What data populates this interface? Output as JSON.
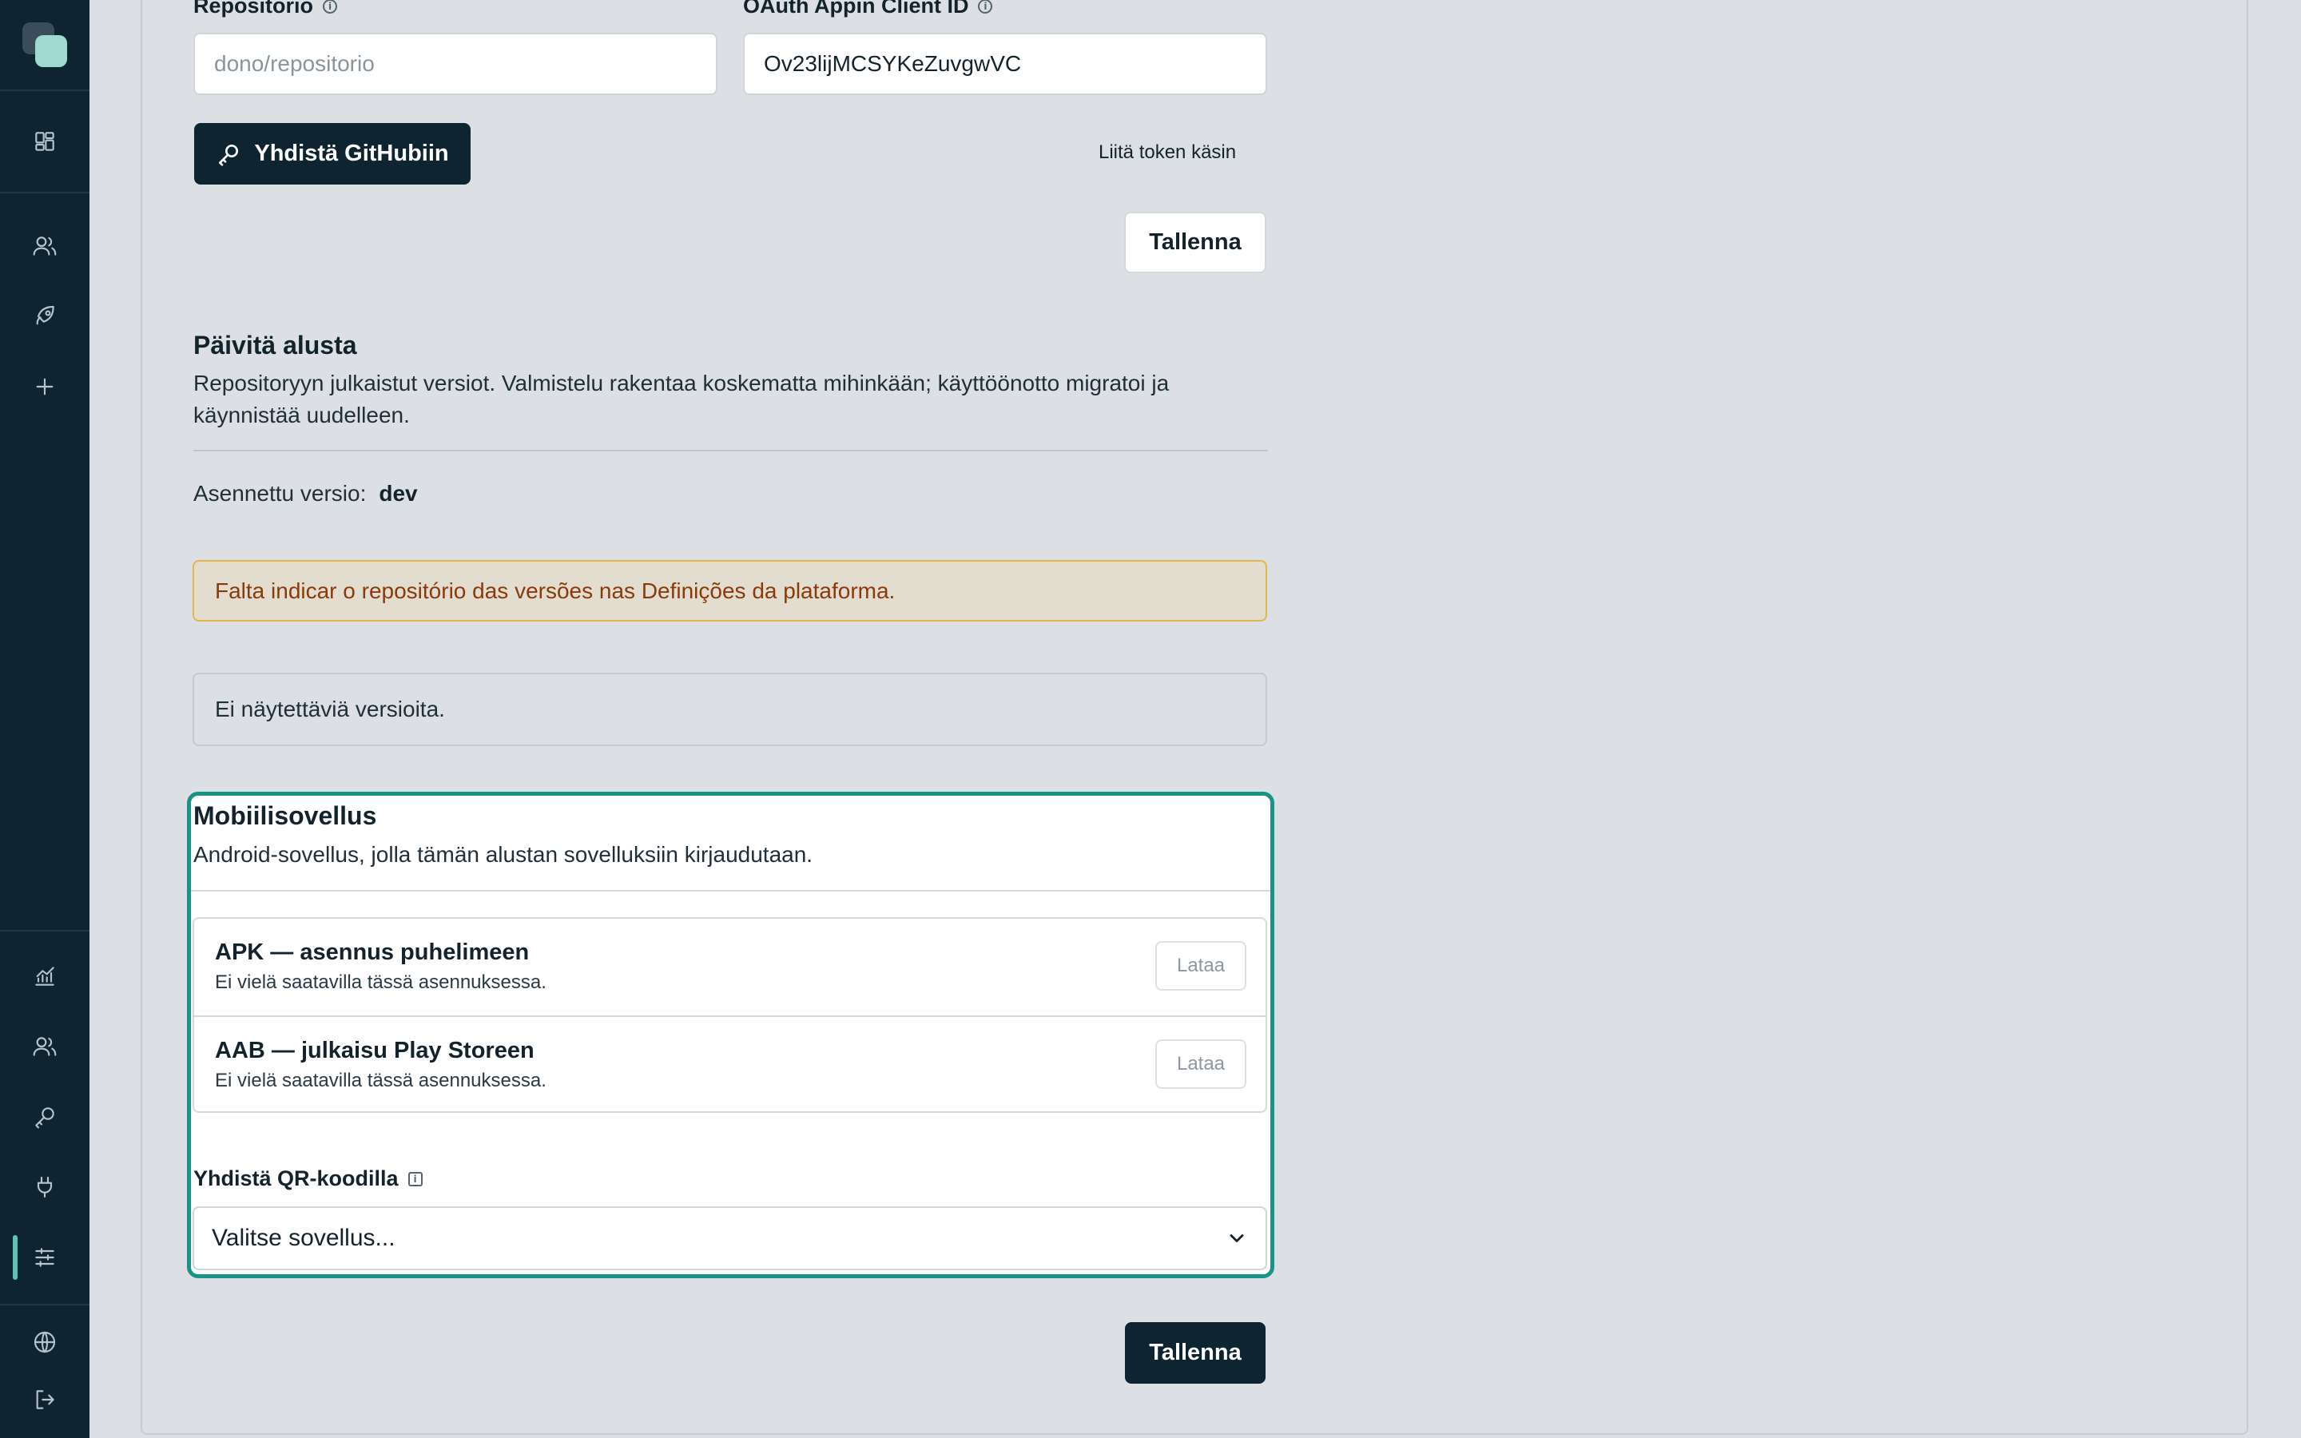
{
  "github": {
    "repo_label": "Repositorio",
    "repo_placeholder": "dono/repositorio",
    "client_id_label": "OAuth Appin Client ID",
    "client_id_value": "Ov23lijMCSYKeZuvgwVC",
    "connect_button": "Yhdistä GitHubiin",
    "manual_token_link": "Liitä token käsin",
    "save_button": "Tallenna"
  },
  "update": {
    "title": "Päivitä alusta",
    "description": "Repositoryyn julkaistut versiot. Valmistelu rakentaa koskematta mihinkään; käyttöönotto migratoi ja käynnistää uudelleen.",
    "installed_label": "Asennettu versio:",
    "installed_value": "dev",
    "warning": "Falta indicar o repositório das versões nas Definições da plataforma.",
    "empty": "Ei näytettäviä versioita."
  },
  "mobile": {
    "title": "Mobiilisovellus",
    "description": "Android-sovellus, jolla tämän alustan sovelluksiin kirjaudutaan.",
    "downloads": [
      {
        "title": "APK — asennus puhelimeen",
        "status": "Ei vielä saatavilla tässä asennuksessa.",
        "button": "Lataa"
      },
      {
        "title": "AAB — julkaisu Play Storeen",
        "status": "Ei vielä saatavilla tässä asennuksessa.",
        "button": "Lataa"
      }
    ],
    "qr_label": "Yhdistä QR-koodilla",
    "qr_select": "Valitse sovellus..."
  },
  "footer": {
    "save_button": "Tallenna"
  },
  "info_glyph": "i",
  "colors": {
    "sidebar": "#0f2431",
    "accent": "#1a9387",
    "warning_border": "#e7b544",
    "warning_text": "#8a3a0a"
  },
  "icons": {
    "sidebar_top": [
      "dashboard-icon",
      "users-icon",
      "rocket-icon",
      "plus-icon"
    ],
    "sidebar_bottom": [
      "analytics-icon",
      "users-icon",
      "key-icon",
      "plug-icon",
      "sliders-icon",
      "globe-icon",
      "logout-icon"
    ]
  }
}
